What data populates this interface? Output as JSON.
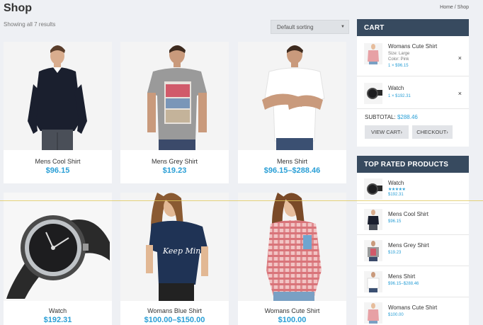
{
  "page": {
    "title": "Shop",
    "breadcrumb": "Home / Shop",
    "result_count": "Showing all 7 results"
  },
  "sorting": {
    "selected": "Default sorting"
  },
  "products": [
    {
      "name": "Mens Cool Shirt",
      "price": "$96.15",
      "image": "man-black-sweater"
    },
    {
      "name": "Mens Grey Shirt",
      "price": "$19.23",
      "image": "man-grey-tshirt"
    },
    {
      "name": "Mens Shirt",
      "price": "$96.15–$288.46",
      "image": "man-white-tshirt"
    },
    {
      "name": "Watch",
      "price": "$192.31",
      "image": "wristwatch"
    },
    {
      "name": "Womans Blue Shirt",
      "price": "$100.00–$150.00",
      "image": "woman-navy-tshirt"
    },
    {
      "name": "Womans Cute Shirt",
      "price": "$100.00",
      "image": "woman-pink-plaid-shirt"
    }
  ],
  "cart": {
    "heading": "CART",
    "items": [
      {
        "title": "Womans Cute Shirt",
        "size": "Size: Large",
        "color": "Color: Pink",
        "qty": "1 × $96.15",
        "remove": "×"
      },
      {
        "title": "Watch",
        "qty": "1 × $192.31",
        "remove": "×"
      }
    ],
    "subtotal_label": "SUBTOTAL:",
    "subtotal_value": "$288.46",
    "view_cart": "VIEW CART›",
    "checkout": "CHECKOUT›"
  },
  "top_rated": {
    "heading": "TOP RATED PRODUCTS",
    "items": [
      {
        "title": "Watch",
        "stars": "★★★★★",
        "rating": 5,
        "price": "$192.31"
      },
      {
        "title": "Mens Cool Shirt",
        "price": "$96.15"
      },
      {
        "title": "Mens Grey Shirt",
        "price": "$19.23"
      },
      {
        "title": "Mens Shirt",
        "price": "$96.15–$288.46"
      },
      {
        "title": "Womans Cute Shirt",
        "price": "$100.00"
      }
    ]
  },
  "colors": {
    "accent": "#2a9fd6",
    "widget_header": "#374a5f",
    "background": "#eef0f4"
  }
}
